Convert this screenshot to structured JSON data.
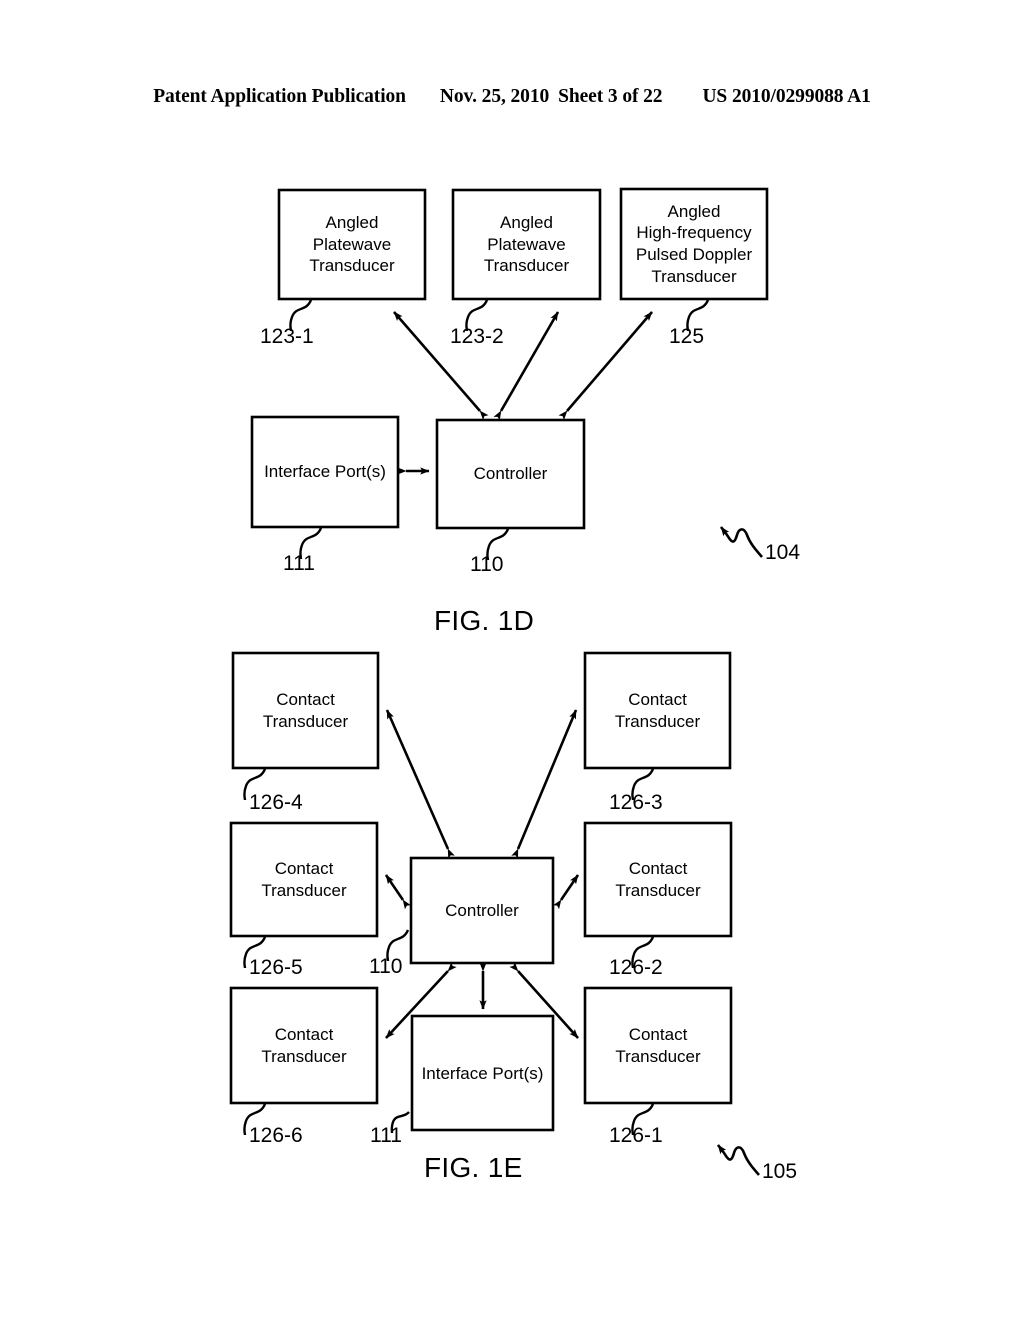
{
  "header": {
    "publication": "Patent Application Publication",
    "date": "Nov. 25, 2010",
    "sheet": "Sheet 3 of 22",
    "patent_number": "US 2010/0299088 A1"
  },
  "figures": [
    {
      "caption": "FIG. 1D",
      "system_ref": "104",
      "boxes": [
        {
          "id": "angled-platewave-transducer-1",
          "ref": "123-1",
          "lines": [
            "Angled",
            "Platewave",
            "Transducer"
          ]
        },
        {
          "id": "angled-platewave-transducer-2",
          "ref": "123-2",
          "lines": [
            "Angled",
            "Platewave",
            "Transducer"
          ]
        },
        {
          "id": "angled-hf-pulsed-doppler-transducer",
          "ref": "125",
          "lines": [
            "Angled",
            "High-frequency",
            "Pulsed Doppler",
            "Transducer"
          ]
        },
        {
          "id": "interface-ports",
          "ref": "111",
          "lines": [
            "Interface Port(s)"
          ]
        },
        {
          "id": "controller",
          "ref": "110",
          "lines": [
            "Controller"
          ]
        }
      ]
    },
    {
      "caption": "FIG. 1E",
      "system_ref": "105",
      "boxes": [
        {
          "id": "contact-transducer-4",
          "ref": "126-4",
          "lines": [
            "Contact",
            "Transducer"
          ]
        },
        {
          "id": "contact-transducer-3",
          "ref": "126-3",
          "lines": [
            "Contact",
            "Transducer"
          ]
        },
        {
          "id": "contact-transducer-5",
          "ref": "126-5",
          "lines": [
            "Contact",
            "Transducer"
          ]
        },
        {
          "id": "contact-transducer-2",
          "ref": "126-2",
          "lines": [
            "Contact",
            "Transducer"
          ]
        },
        {
          "id": "contact-transducer-6",
          "ref": "126-6",
          "lines": [
            "Contact",
            "Transducer"
          ]
        },
        {
          "id": "contact-transducer-1",
          "ref": "126-1",
          "lines": [
            "Contact",
            "Transducer"
          ]
        },
        {
          "id": "controller",
          "ref": "110",
          "lines": [
            "Controller"
          ]
        },
        {
          "id": "interface-ports",
          "ref": "111",
          "lines": [
            "Interface Port(s)"
          ]
        }
      ]
    }
  ],
  "colors": {
    "ink": "#000000",
    "paper": "#ffffff"
  }
}
